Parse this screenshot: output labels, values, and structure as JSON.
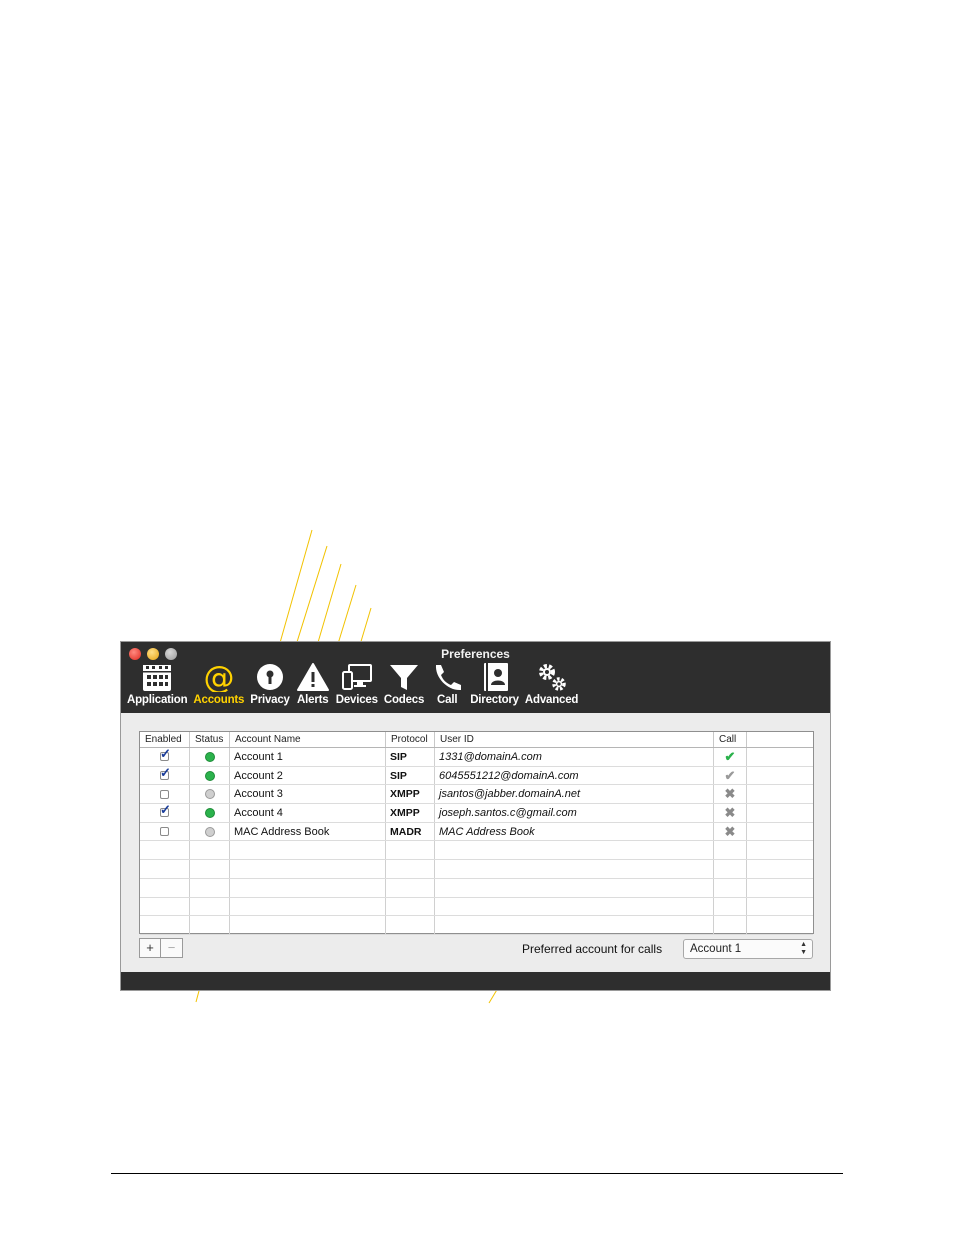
{
  "window": {
    "title": "Preferences"
  },
  "toolbar": [
    {
      "label": "Application",
      "icon": "calendar-grid-icon",
      "active": false
    },
    {
      "label": "Accounts",
      "icon": "at-sign-icon",
      "active": true
    },
    {
      "label": "Privacy",
      "icon": "keyhole-icon",
      "active": false
    },
    {
      "label": "Alerts",
      "icon": "warning-triangle-icon",
      "active": false
    },
    {
      "label": "Devices",
      "icon": "monitor-phone-icon",
      "active": false
    },
    {
      "label": "Codecs",
      "icon": "funnel-icon",
      "active": false
    },
    {
      "label": "Call",
      "icon": "phone-handset-icon",
      "active": false
    },
    {
      "label": "Directory",
      "icon": "address-book-icon",
      "active": false
    },
    {
      "label": "Advanced",
      "icon": "gears-icon",
      "active": false
    }
  ],
  "accounts_table": {
    "columns": [
      "Enabled",
      "Status",
      "Account Name",
      "Protocol",
      "User ID",
      "Call"
    ],
    "rows": [
      {
        "enabled": true,
        "status": "online",
        "name": "Account 1",
        "protocol": "SIP",
        "user_id": "1331@domainA.com",
        "call": "check-green"
      },
      {
        "enabled": true,
        "status": "online",
        "name": "Account 2",
        "protocol": "SIP",
        "user_id": "6045551212@domainA.com",
        "call": "check-gray"
      },
      {
        "enabled": false,
        "status": "offline",
        "name": "Account 3",
        "protocol": "XMPP",
        "user_id": "jsantos@jabber.domainA.net",
        "call": "cross"
      },
      {
        "enabled": true,
        "status": "online",
        "name": "Account 4",
        "protocol": "XMPP",
        "user_id": "joseph.santos.c@gmail.com",
        "call": "cross"
      },
      {
        "enabled": false,
        "status": "offline",
        "name": "MAC Address Book",
        "protocol": "MADR",
        "user_id": "MAC Address Book",
        "call": "cross"
      }
    ],
    "empty_rows": 5
  },
  "buttons": {
    "add_label": "+",
    "remove_label": "−"
  },
  "preferred": {
    "label": "Preferred account for calls",
    "selected": "Account 1"
  },
  "colors": {
    "titlebar": "#2e2e2e",
    "accent": "#ffd200",
    "callout_line": "#f2c200",
    "status_online": "#2bb24c",
    "status_offline": "#cfcfcf"
  }
}
